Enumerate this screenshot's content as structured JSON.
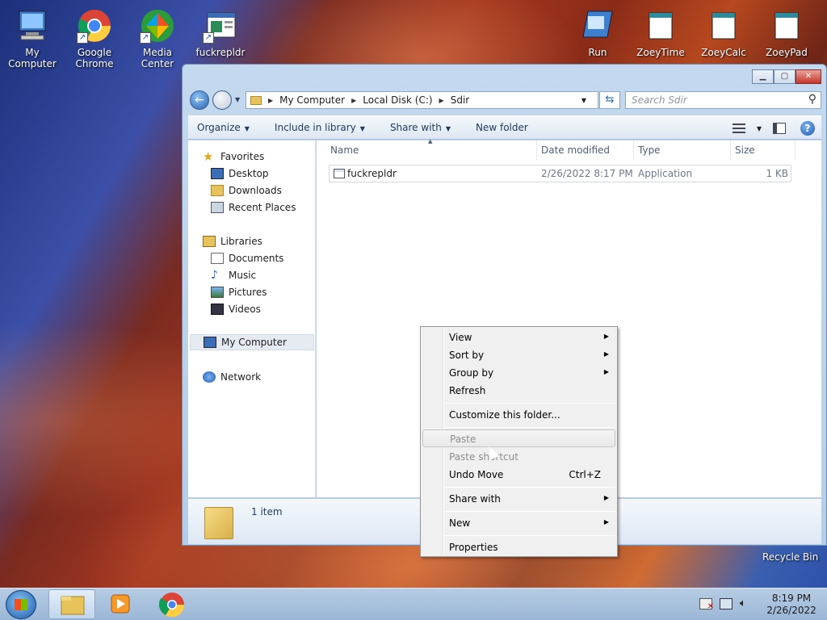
{
  "desktop": {
    "icons_left": [
      {
        "label": "My Computer",
        "name": "my-computer-icon"
      },
      {
        "label": "Google Chrome",
        "name": "chrome-icon"
      },
      {
        "label": "Media Center",
        "name": "media-center-icon"
      },
      {
        "label": "fuckrepldr",
        "name": "app-shortcut-icon"
      }
    ],
    "icons_right": [
      {
        "label": "Run",
        "name": "run-icon"
      },
      {
        "label": "ZoeyTime",
        "name": "zoeytime-icon"
      },
      {
        "label": "ZoeyCalc",
        "name": "zoeycalc-icon"
      },
      {
        "label": "ZoeyPad",
        "name": "zoeypad-icon"
      }
    ],
    "recycle_bin": "Recycle Bin"
  },
  "window": {
    "address": [
      "My Computer",
      "Local Disk (C:)",
      "Sdir"
    ],
    "search_placeholder": "Search Sdir",
    "toolbar": {
      "organize": "Organize",
      "include": "Include in library",
      "share": "Share with",
      "new_folder": "New folder"
    },
    "nav": {
      "favorites": "Favorites",
      "desktop": "Desktop",
      "downloads": "Downloads",
      "recent": "Recent Places",
      "libraries": "Libraries",
      "documents": "Documents",
      "music": "Music",
      "pictures": "Pictures",
      "videos": "Videos",
      "computer": "My Computer",
      "network": "Network"
    },
    "columns": {
      "name": "Name",
      "date": "Date modified",
      "type": "Type",
      "size": "Size"
    },
    "files": [
      {
        "name": "fuckrepldr",
        "date": "2/26/2022 8:17 PM",
        "type": "Application",
        "size": "1 KB"
      }
    ],
    "item_count": "1 item"
  },
  "context_menu": {
    "view": "View",
    "sort_by": "Sort by",
    "group_by": "Group by",
    "refresh": "Refresh",
    "customize": "Customize this folder...",
    "paste": "Paste",
    "paste_shortcut": "Paste shortcut",
    "undo_move": "Undo Move",
    "undo_shortcut": "Ctrl+Z",
    "share_with": "Share with",
    "new": "New",
    "properties": "Properties"
  },
  "taskbar": {
    "time": "8:19 PM",
    "date": "2/26/2022"
  }
}
